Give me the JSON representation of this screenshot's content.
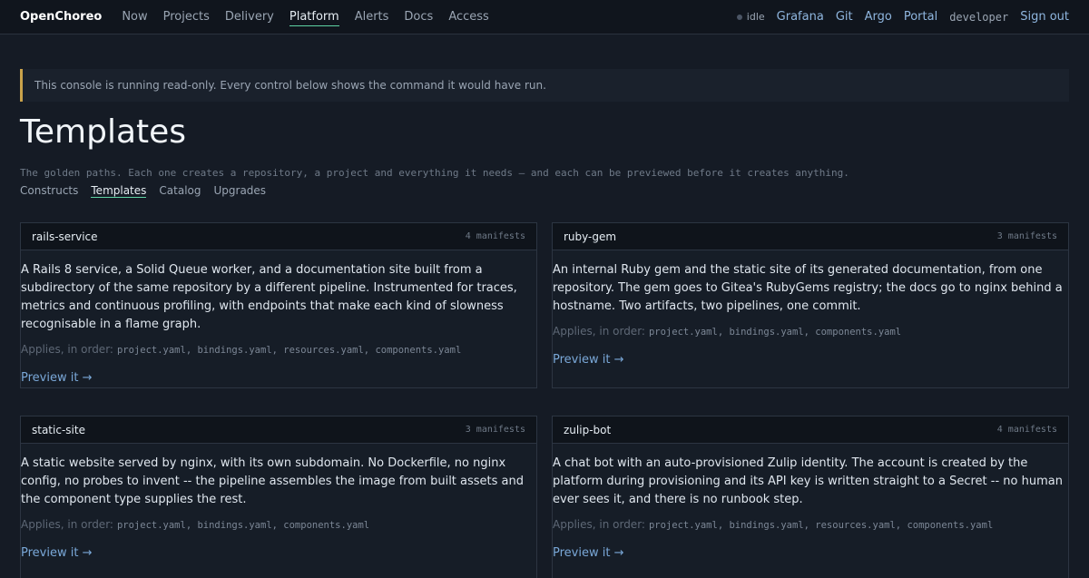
{
  "topbar": {
    "brand": "OpenChoreo",
    "nav": [
      "Now",
      "Projects",
      "Delivery",
      "Platform",
      "Alerts",
      "Docs",
      "Access"
    ],
    "active": "Platform",
    "status": "idle",
    "links": [
      "Grafana",
      "Git",
      "Argo",
      "Portal"
    ],
    "user": "developer",
    "signout": "Sign out"
  },
  "banner": "This console is running read-only. Every control below shows the command it would have run.",
  "page": {
    "title": "Templates",
    "subtitle": "The golden paths. Each one creates a repository, a project and everything it needs — and each can be previewed before it creates anything."
  },
  "subnav": {
    "items": [
      "Constructs",
      "Templates",
      "Catalog",
      "Upgrades"
    ],
    "active": "Templates"
  },
  "applies_label": "Applies, in order:",
  "preview_label": "Preview it →",
  "templates": [
    {
      "name": "rails-service",
      "count": "4 manifests",
      "description": "A Rails 8 service, a Solid Queue worker, and a documentation site built from a subdirectory of the same repository by a different pipeline. Instrumented for traces, metrics and continuous profiling, with endpoints that make each kind of slowness recognisable in a flame graph.",
      "files": "project.yaml, bindings.yaml, resources.yaml, components.yaml"
    },
    {
      "name": "ruby-gem",
      "count": "3 manifests",
      "description": "An internal Ruby gem and the static site of its generated documentation, from one repository. The gem goes to Gitea's RubyGems registry; the docs go to nginx behind a hostname. Two artifacts, two pipelines, one commit.",
      "files": "project.yaml, bindings.yaml, components.yaml"
    },
    {
      "name": "static-site",
      "count": "3 manifests",
      "description": "A static website served by nginx, with its own subdomain. No Dockerfile, no nginx config, no probes to invent -- the pipeline assembles the image from built assets and the component type supplies the rest.",
      "files": "project.yaml, bindings.yaml, components.yaml"
    },
    {
      "name": "zulip-bot",
      "count": "4 manifests",
      "description": "A chat bot with an auto-provisioned Zulip identity. The account is created by the platform during provisioning and its API key is written straight to a Secret -- no human ever sees it, and there is no runbook step.",
      "files": "project.yaml, bindings.yaml, resources.yaml, components.yaml"
    }
  ]
}
